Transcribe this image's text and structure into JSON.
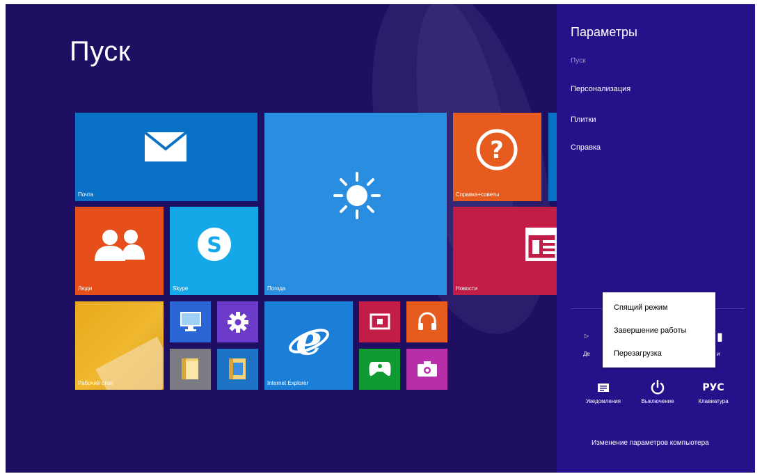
{
  "start": {
    "title": "Пуск"
  },
  "tiles": {
    "mail": "Почта",
    "people": "Люди",
    "skype": "Skype",
    "weather": "Погода",
    "help": "Справка+советы",
    "news": "Новости",
    "desktop": "Рабочий стол",
    "ie": "Internet Explorer"
  },
  "settings_pane": {
    "title": "Параметры",
    "subtitle": "Пуск",
    "items": [
      "Персонализация",
      "Плитки",
      "Справка"
    ],
    "partial_left": "Де",
    "partial_right": "и",
    "quick_actions": [
      {
        "label": "Уведомления",
        "icon": "notifications-icon"
      },
      {
        "label": "Выключение",
        "icon": "power-icon"
      },
      {
        "label": "Клавиатура",
        "icon_text": "РУС"
      }
    ],
    "change_pc_settings": "Изменение параметров компьютера"
  },
  "power_menu": {
    "items": [
      "Спящий режим",
      "Завершение работы",
      "Перезагрузка"
    ]
  }
}
